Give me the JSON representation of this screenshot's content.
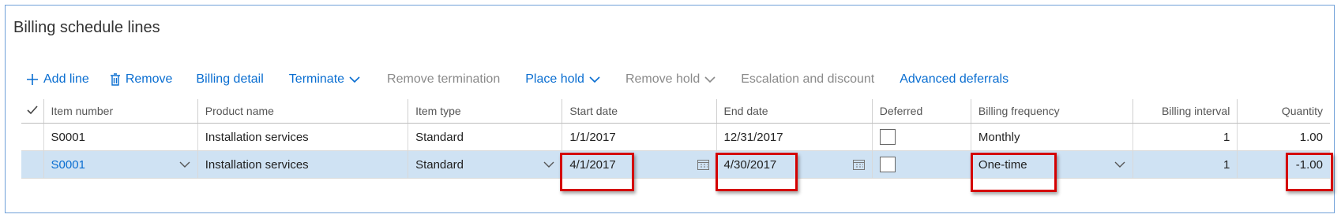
{
  "title": "Billing schedule lines",
  "toolbar": {
    "add_line": "Add line",
    "remove": "Remove",
    "billing_detail": "Billing detail",
    "terminate": "Terminate",
    "remove_termination": "Remove termination",
    "place_hold": "Place hold",
    "remove_hold": "Remove hold",
    "escalation_discount": "Escalation and discount",
    "advanced_deferrals": "Advanced deferrals"
  },
  "grid": {
    "headers": {
      "item_number": "Item number",
      "product_name": "Product name",
      "item_type": "Item type",
      "start_date": "Start date",
      "end_date": "End date",
      "deferred": "Deferred",
      "billing_frequency": "Billing frequency",
      "billing_interval": "Billing interval",
      "quantity": "Quantity"
    },
    "rows": [
      {
        "item_number": "S0001",
        "product_name": "Installation services",
        "item_type": "Standard",
        "start_date": "1/1/2017",
        "end_date": "12/31/2017",
        "deferred": false,
        "billing_frequency": "Monthly",
        "billing_interval": "1",
        "quantity": "1.00"
      },
      {
        "item_number": "S0001",
        "product_name": "Installation services",
        "item_type": "Standard",
        "start_date": "4/1/2017",
        "end_date": "4/30/2017",
        "deferred": false,
        "billing_frequency": "One-time",
        "billing_interval": "1",
        "quantity": "-1.00",
        "selected": true
      }
    ]
  },
  "colors": {
    "accent": "#0a6ed1",
    "disabled": "#8a8a8a",
    "selected_row": "#cfe2f3",
    "highlight": "#d40000"
  }
}
